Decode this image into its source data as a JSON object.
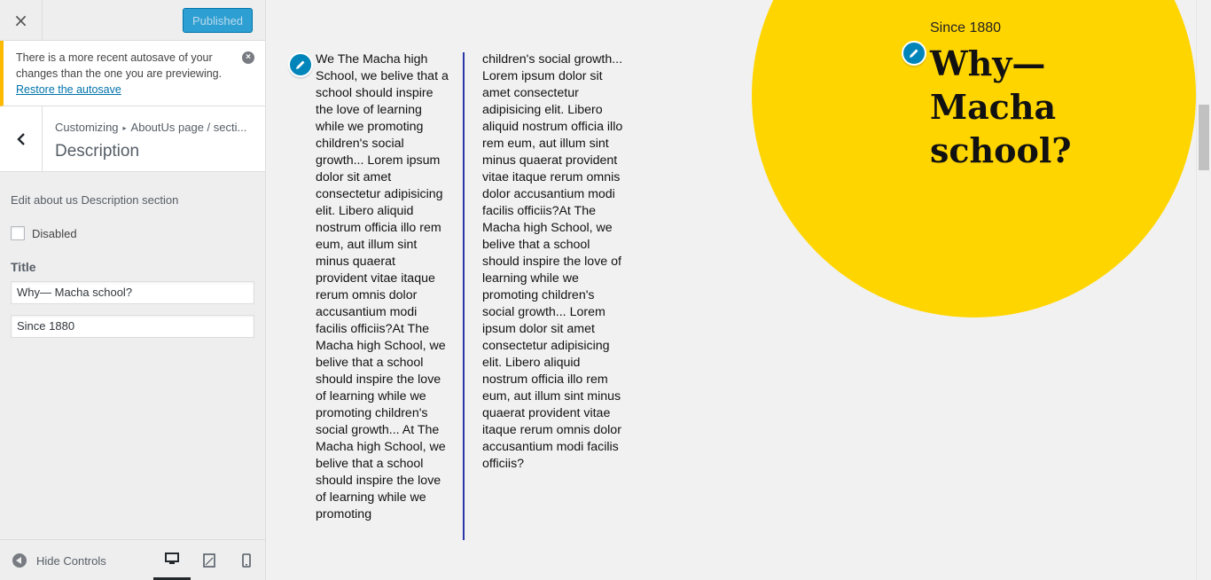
{
  "topbar": {
    "close_symbol": "×",
    "publish_label": "Published"
  },
  "notice": {
    "text": "There is a more recent autosave of your changes than the one you are previewing.",
    "link": "Restore the autosave",
    "dismiss_symbol": "×"
  },
  "section": {
    "breadcrumb_root": "Customizing",
    "breadcrumb_path": "AboutUs page / secti...",
    "title": "Description"
  },
  "controls": {
    "description": "Edit about us Description section",
    "disabled_label": "Disabled",
    "title_label": "Title",
    "title_value": "Why— Macha school?",
    "subtitle_value": "Since 1880"
  },
  "footer": {
    "hide_controls_label": "Hide Controls"
  },
  "preview": {
    "column1": "We The Macha high School, we belive that a school should inspire the love of learning while we promoting children's social growth... Lorem ipsum dolor sit amet consectetur adipisicing elit. Libero aliquid nostrum officia illo rem eum, aut illum sint minus quaerat provident vitae itaque rerum omnis dolor accusantium modi facilis officiis?At The Macha high School, we belive that a school should inspire the love of learning while we promoting children's social growth... At The Macha high School, we belive that a school should inspire the love of learning while we promoting",
    "column2": "children's social growth... Lorem ipsum dolor sit amet consectetur adipisicing elit. Libero aliquid nostrum officia illo rem eum, aut illum sint minus quaerat provident vitae itaque rerum omnis dolor accusantium modi facilis officiis?At The Macha high School, we belive that a school should inspire the love of learning while we promoting children's social growth... Lorem ipsum dolor sit amet consectetur adipisicing elit. Libero aliquid nostrum officia illo rem eum, aut illum sint minus quaerat provident vitae itaque rerum omnis dolor accusantium modi facilis officiis?",
    "since": "Since 1880",
    "heading": "Why— Macha school?"
  },
  "colors": {
    "accent": "#0085ba",
    "publish_bg": "#2e9fd2",
    "circle": "#ffd500",
    "divider": "#2b36a8",
    "notice_border": "#ffb900"
  },
  "icons": {
    "close": "close-icon",
    "dismiss": "dismiss-icon",
    "back": "chevron-left-icon",
    "pencil": "pencil-icon",
    "hide": "arrow-left-circle-icon",
    "desktop": "desktop-icon",
    "tablet": "tablet-icon",
    "mobile": "mobile-icon"
  }
}
